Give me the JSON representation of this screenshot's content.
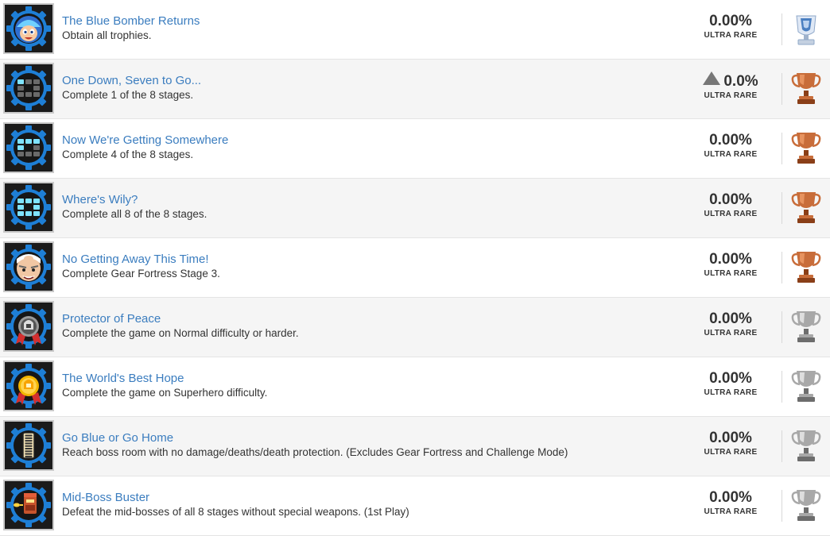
{
  "rarity_label": "ULTRA RARE",
  "colors": {
    "link": "#3b7dbf",
    "platinum": "#4a7fc1",
    "bronze": "#c86d3a",
    "silver": "#a8a8a8",
    "gear_blue": "#1e7fd6"
  },
  "trophies": [
    {
      "title": "The Blue Bomber Returns",
      "description": "Obtain all trophies.",
      "percent": "0.00%",
      "trend_icon": false,
      "grade": "platinum",
      "image": "megaman-face"
    },
    {
      "title": "One Down, Seven to Go...",
      "description": "Complete 1 of the 8 stages.",
      "percent": "0.0%",
      "trend_icon": true,
      "grade": "bronze",
      "image": "stages-1"
    },
    {
      "title": "Now We're Getting Somewhere",
      "description": "Complete 4 of the 8 stages.",
      "percent": "0.00%",
      "trend_icon": false,
      "grade": "bronze",
      "image": "stages-4"
    },
    {
      "title": "Where's Wily?",
      "description": "Complete all 8 of the 8 stages.",
      "percent": "0.00%",
      "trend_icon": false,
      "grade": "bronze",
      "image": "stages-8"
    },
    {
      "title": "No Getting Away This Time!",
      "description": "Complete Gear Fortress Stage 3.",
      "percent": "0.00%",
      "trend_icon": false,
      "grade": "bronze",
      "image": "wily-face"
    },
    {
      "title": "Protector of Peace",
      "description": "Complete the game on Normal difficulty or harder.",
      "percent": "0.00%",
      "trend_icon": false,
      "grade": "silver",
      "image": "silver-medal"
    },
    {
      "title": "The World's Best Hope",
      "description": "Complete the game on Superhero difficulty.",
      "percent": "0.00%",
      "trend_icon": false,
      "grade": "silver",
      "image": "gold-medal"
    },
    {
      "title": "Go Blue or Go Home",
      "description": "Reach boss room with no damage/deaths/death protection. (Excludes Gear Fortress and Challenge Mode)",
      "percent": "0.00%",
      "trend_icon": false,
      "grade": "silver",
      "image": "energy-bar"
    },
    {
      "title": "Mid-Boss Buster",
      "description": "Defeat the mid-bosses of all 8 stages without special weapons. (1st Play)",
      "percent": "0.00%",
      "trend_icon": false,
      "grade": "silver",
      "image": "mid-boss"
    }
  ]
}
